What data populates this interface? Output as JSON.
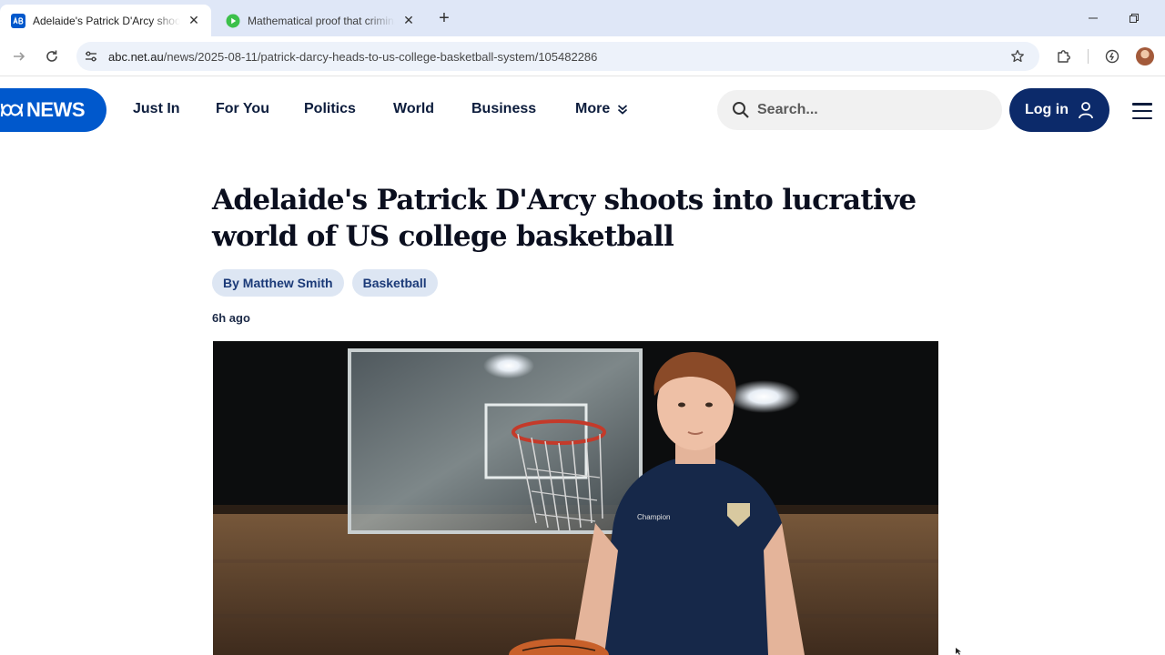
{
  "browser": {
    "tabs": [
      {
        "title": "Adelaide's Patrick D'Arcy shoots into lucrative world of US college basketball",
        "active": true,
        "favicon": "abc-icon"
      },
      {
        "title": "Mathematical proof that criminals are smarter than you",
        "active": false,
        "favicon": "play-icon"
      }
    ],
    "new_tab_label": "+",
    "address": {
      "domain": "abc.net.au",
      "path": "/news/2025-08-11/patrick-darcy-heads-to-us-college-basketball-system/105482286"
    }
  },
  "site": {
    "logo_text": "NEWS",
    "nav": {
      "just_in": "Just In",
      "for_you": "For You",
      "politics": "Politics",
      "world": "World",
      "business": "Business",
      "more": "More"
    },
    "search_placeholder": "Search...",
    "login_label": "Log in"
  },
  "article": {
    "headline": "Adelaide's Patrick D'Arcy shoots into lucrative world of US college basketball",
    "byline": "By Matthew Smith",
    "topic": "Basketball",
    "published": "6h ago"
  },
  "colors": {
    "abc_blue": "#0058cc",
    "login_navy": "#0c2a6a",
    "pill_bg": "#dde6f3",
    "tabstrip": "#dfe7f7"
  }
}
